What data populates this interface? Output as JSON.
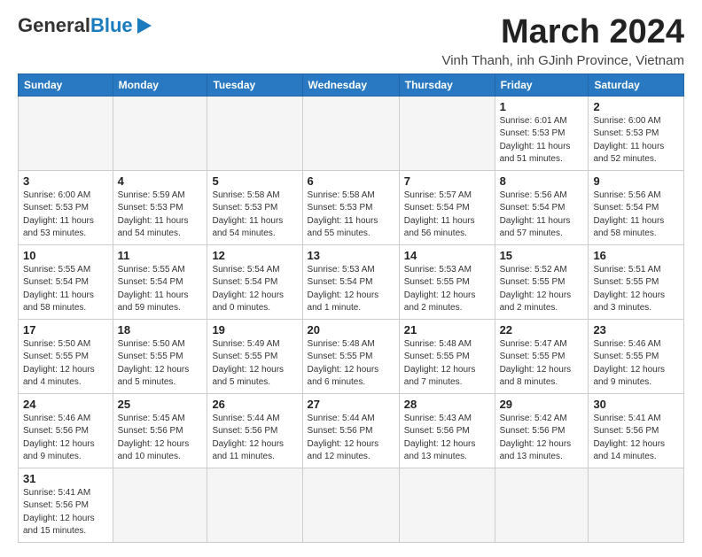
{
  "header": {
    "logo_general": "General",
    "logo_blue": "Blue",
    "month_title": "March 2024",
    "subtitle": "Vinh Thanh, inh GJinh Province, Vietnam"
  },
  "weekdays": [
    "Sunday",
    "Monday",
    "Tuesday",
    "Wednesday",
    "Thursday",
    "Friday",
    "Saturday"
  ],
  "weeks": [
    [
      {
        "day": "",
        "info": ""
      },
      {
        "day": "",
        "info": ""
      },
      {
        "day": "",
        "info": ""
      },
      {
        "day": "",
        "info": ""
      },
      {
        "day": "",
        "info": ""
      },
      {
        "day": "1",
        "info": "Sunrise: 6:01 AM\nSunset: 5:53 PM\nDaylight: 11 hours\nand 51 minutes."
      },
      {
        "day": "2",
        "info": "Sunrise: 6:00 AM\nSunset: 5:53 PM\nDaylight: 11 hours\nand 52 minutes."
      }
    ],
    [
      {
        "day": "3",
        "info": "Sunrise: 6:00 AM\nSunset: 5:53 PM\nDaylight: 11 hours\nand 53 minutes."
      },
      {
        "day": "4",
        "info": "Sunrise: 5:59 AM\nSunset: 5:53 PM\nDaylight: 11 hours\nand 54 minutes."
      },
      {
        "day": "5",
        "info": "Sunrise: 5:58 AM\nSunset: 5:53 PM\nDaylight: 11 hours\nand 54 minutes."
      },
      {
        "day": "6",
        "info": "Sunrise: 5:58 AM\nSunset: 5:53 PM\nDaylight: 11 hours\nand 55 minutes."
      },
      {
        "day": "7",
        "info": "Sunrise: 5:57 AM\nSunset: 5:54 PM\nDaylight: 11 hours\nand 56 minutes."
      },
      {
        "day": "8",
        "info": "Sunrise: 5:56 AM\nSunset: 5:54 PM\nDaylight: 11 hours\nand 57 minutes."
      },
      {
        "day": "9",
        "info": "Sunrise: 5:56 AM\nSunset: 5:54 PM\nDaylight: 11 hours\nand 58 minutes."
      }
    ],
    [
      {
        "day": "10",
        "info": "Sunrise: 5:55 AM\nSunset: 5:54 PM\nDaylight: 11 hours\nand 58 minutes."
      },
      {
        "day": "11",
        "info": "Sunrise: 5:55 AM\nSunset: 5:54 PM\nDaylight: 11 hours\nand 59 minutes."
      },
      {
        "day": "12",
        "info": "Sunrise: 5:54 AM\nSunset: 5:54 PM\nDaylight: 12 hours\nand 0 minutes."
      },
      {
        "day": "13",
        "info": "Sunrise: 5:53 AM\nSunset: 5:54 PM\nDaylight: 12 hours\nand 1 minute."
      },
      {
        "day": "14",
        "info": "Sunrise: 5:53 AM\nSunset: 5:55 PM\nDaylight: 12 hours\nand 2 minutes."
      },
      {
        "day": "15",
        "info": "Sunrise: 5:52 AM\nSunset: 5:55 PM\nDaylight: 12 hours\nand 2 minutes."
      },
      {
        "day": "16",
        "info": "Sunrise: 5:51 AM\nSunset: 5:55 PM\nDaylight: 12 hours\nand 3 minutes."
      }
    ],
    [
      {
        "day": "17",
        "info": "Sunrise: 5:50 AM\nSunset: 5:55 PM\nDaylight: 12 hours\nand 4 minutes."
      },
      {
        "day": "18",
        "info": "Sunrise: 5:50 AM\nSunset: 5:55 PM\nDaylight: 12 hours\nand 5 minutes."
      },
      {
        "day": "19",
        "info": "Sunrise: 5:49 AM\nSunset: 5:55 PM\nDaylight: 12 hours\nand 5 minutes."
      },
      {
        "day": "20",
        "info": "Sunrise: 5:48 AM\nSunset: 5:55 PM\nDaylight: 12 hours\nand 6 minutes."
      },
      {
        "day": "21",
        "info": "Sunrise: 5:48 AM\nSunset: 5:55 PM\nDaylight: 12 hours\nand 7 minutes."
      },
      {
        "day": "22",
        "info": "Sunrise: 5:47 AM\nSunset: 5:55 PM\nDaylight: 12 hours\nand 8 minutes."
      },
      {
        "day": "23",
        "info": "Sunrise: 5:46 AM\nSunset: 5:55 PM\nDaylight: 12 hours\nand 9 minutes."
      }
    ],
    [
      {
        "day": "24",
        "info": "Sunrise: 5:46 AM\nSunset: 5:56 PM\nDaylight: 12 hours\nand 9 minutes."
      },
      {
        "day": "25",
        "info": "Sunrise: 5:45 AM\nSunset: 5:56 PM\nDaylight: 12 hours\nand 10 minutes."
      },
      {
        "day": "26",
        "info": "Sunrise: 5:44 AM\nSunset: 5:56 PM\nDaylight: 12 hours\nand 11 minutes."
      },
      {
        "day": "27",
        "info": "Sunrise: 5:44 AM\nSunset: 5:56 PM\nDaylight: 12 hours\nand 12 minutes."
      },
      {
        "day": "28",
        "info": "Sunrise: 5:43 AM\nSunset: 5:56 PM\nDaylight: 12 hours\nand 13 minutes."
      },
      {
        "day": "29",
        "info": "Sunrise: 5:42 AM\nSunset: 5:56 PM\nDaylight: 12 hours\nand 13 minutes."
      },
      {
        "day": "30",
        "info": "Sunrise: 5:41 AM\nSunset: 5:56 PM\nDaylight: 12 hours\nand 14 minutes."
      }
    ],
    [
      {
        "day": "31",
        "info": "Sunrise: 5:41 AM\nSunset: 5:56 PM\nDaylight: 12 hours\nand 15 minutes."
      },
      {
        "day": "",
        "info": ""
      },
      {
        "day": "",
        "info": ""
      },
      {
        "day": "",
        "info": ""
      },
      {
        "day": "",
        "info": ""
      },
      {
        "day": "",
        "info": ""
      },
      {
        "day": "",
        "info": ""
      }
    ]
  ]
}
